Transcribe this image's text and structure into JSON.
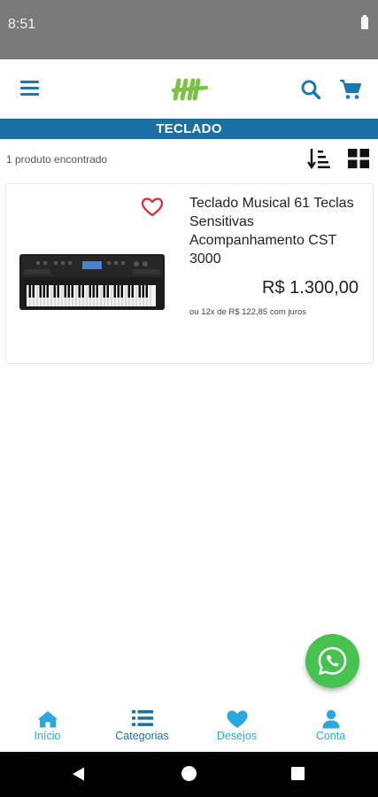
{
  "status_bar": {
    "time": "8:51"
  },
  "header": {
    "category_title": "TECLADO"
  },
  "results": {
    "count_text": "1 produto encontrado"
  },
  "product": {
    "title": "Teclado Musical 61 Teclas Sensitivas Acompanhamento CST 3000",
    "price": "R$ 1.300,00",
    "installments": "ou 12x de R$ 122,85 com juros"
  },
  "bottom_nav": {
    "items": [
      {
        "label": "Início",
        "icon": "home-icon"
      },
      {
        "label": "Categorias",
        "icon": "list-icon"
      },
      {
        "label": "Desejos",
        "icon": "heart-icon"
      },
      {
        "label": "Conta",
        "icon": "user-icon"
      }
    ]
  },
  "colors": {
    "primary_blue": "#1b6fa3",
    "nav_light_blue": "#29a8e0",
    "logo_green": "#7cc242",
    "favorite_red": "#e0262f",
    "whatsapp_green": "#48c24f"
  }
}
